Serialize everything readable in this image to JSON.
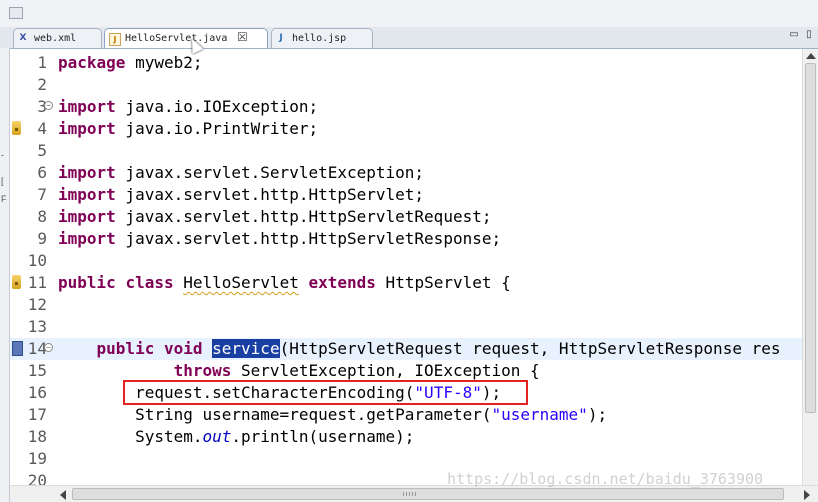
{
  "tabs": [
    {
      "label": "web.xml",
      "icon": "xml-file-icon",
      "active": false
    },
    {
      "label": "HelloServlet.java",
      "icon": "java-file-icon",
      "active": true,
      "close": "☒"
    },
    {
      "label": "hello.jsp",
      "icon": "jsp-file-icon",
      "active": false
    }
  ],
  "window_buttons": {
    "minimize": "▭",
    "maximize": "▯"
  },
  "editor": {
    "lines": [
      {
        "num": "1"
      },
      {
        "num": "2"
      },
      {
        "num": "3"
      },
      {
        "num": "4"
      },
      {
        "num": "5"
      },
      {
        "num": "6"
      },
      {
        "num": "7"
      },
      {
        "num": "8"
      },
      {
        "num": "9"
      },
      {
        "num": "10"
      },
      {
        "num": "11"
      },
      {
        "num": "12"
      },
      {
        "num": "13"
      },
      {
        "num": "14"
      },
      {
        "num": "15"
      },
      {
        "num": "16"
      },
      {
        "num": "17"
      },
      {
        "num": "18"
      },
      {
        "num": "19"
      },
      {
        "num": "20"
      }
    ],
    "code": {
      "package_kw": "package",
      "package_name": " myweb2;",
      "import_kw": "import",
      "imports": [
        " java.io.IOException;",
        " java.io.PrintWriter;",
        " javax.servlet.ServletException;",
        " javax.servlet.http.HttpServlet;",
        " javax.servlet.http.HttpServletRequest;",
        " javax.servlet.http.HttpServletResponse;"
      ],
      "public_kw": "public",
      "class_kw": "class",
      "class_name": "HelloServlet",
      "extends_kw": "extends",
      "class_tail": " HttpServlet {",
      "void_kw": "void",
      "method_name": "service",
      "method_params": "(HttpServletRequest request, HttpServletResponse res",
      "throws_kw": "throws",
      "throws_list": " ServletException, IOException {",
      "line16_pre": "request.setCharacterEncoding(",
      "line16_str": "\"UTF-8\"",
      "line16_post": ");",
      "line17_pre": "String username=request.getParameter(",
      "line17_str": "\"username\"",
      "line17_post": ");",
      "line18_pre": "System.",
      "line18_field": "out",
      "line18_post": ".println(username);"
    }
  },
  "watermark": "https://blog.csdn.net/baidu_3763900",
  "colors": {
    "keyword": "#7f0055",
    "string": "#2a00ff",
    "selection": "#1a3fa2",
    "highlight_box": "#e32222",
    "current_line": "#e8f2fe"
  }
}
